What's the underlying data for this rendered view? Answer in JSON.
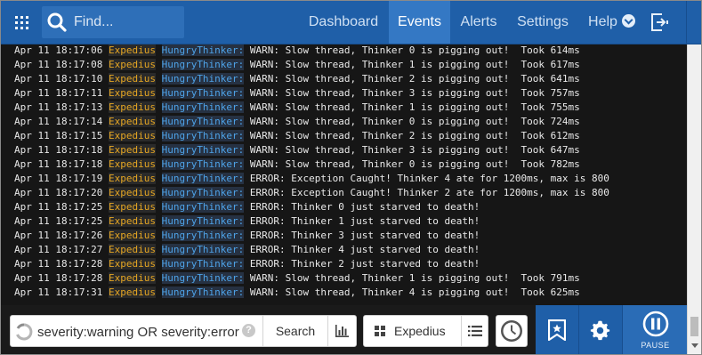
{
  "header": {
    "search_placeholder": "Find...",
    "nav": [
      {
        "label": "Dashboard",
        "active": false
      },
      {
        "label": "Events",
        "active": true
      },
      {
        "label": "Alerts",
        "active": false
      },
      {
        "label": "Settings",
        "active": false
      },
      {
        "label": "Help",
        "active": false
      }
    ],
    "icons": [
      "apps-grid-icon",
      "search-icon",
      "chevron-down-icon",
      "sign-out-icon"
    ]
  },
  "log": {
    "rows": [
      {
        "time": "Apr 11 18:17:06",
        "host": "Expedius",
        "source": "HungryThinker:",
        "message": "WARN: Slow thread, Thinker 0 is pigging out!  Took 614ms"
      },
      {
        "time": "Apr 11 18:17:08",
        "host": "Expedius",
        "source": "HungryThinker:",
        "message": "WARN: Slow thread, Thinker 1 is pigging out!  Took 617ms"
      },
      {
        "time": "Apr 11 18:17:10",
        "host": "Expedius",
        "source": "HungryThinker:",
        "message": "WARN: Slow thread, Thinker 2 is pigging out!  Took 641ms"
      },
      {
        "time": "Apr 11 18:17:11",
        "host": "Expedius",
        "source": "HungryThinker:",
        "message": "WARN: Slow thread, Thinker 3 is pigging out!  Took 757ms"
      },
      {
        "time": "Apr 11 18:17:13",
        "host": "Expedius",
        "source": "HungryThinker:",
        "message": "WARN: Slow thread, Thinker 1 is pigging out!  Took 755ms"
      },
      {
        "time": "Apr 11 18:17:14",
        "host": "Expedius",
        "source": "HungryThinker:",
        "message": "WARN: Slow thread, Thinker 0 is pigging out!  Took 724ms"
      },
      {
        "time": "Apr 11 18:17:15",
        "host": "Expedius",
        "source": "HungryThinker:",
        "message": "WARN: Slow thread, Thinker 2 is pigging out!  Took 612ms"
      },
      {
        "time": "Apr 11 18:17:18",
        "host": "Expedius",
        "source": "HungryThinker:",
        "message": "WARN: Slow thread, Thinker 3 is pigging out!  Took 647ms"
      },
      {
        "time": "Apr 11 18:17:18",
        "host": "Expedius",
        "source": "HungryThinker:",
        "message": "WARN: Slow thread, Thinker 0 is pigging out!  Took 782ms"
      },
      {
        "time": "Apr 11 18:17:19",
        "host": "Expedius",
        "source": "HungryThinker:",
        "message": "ERROR: Exception Caught! Thinker 4 ate for 1200ms, max is 800"
      },
      {
        "time": "Apr 11 18:17:20",
        "host": "Expedius",
        "source": "HungryThinker:",
        "message": "ERROR: Exception Caught! Thinker 2 ate for 1200ms, max is 800"
      },
      {
        "time": "Apr 11 18:17:25",
        "host": "Expedius",
        "source": "HungryThinker:",
        "message": "ERROR: Thinker 0 just starved to death!"
      },
      {
        "time": "Apr 11 18:17:25",
        "host": "Expedius",
        "source": "HungryThinker:",
        "message": "ERROR: Thinker 1 just starved to death!"
      },
      {
        "time": "Apr 11 18:17:26",
        "host": "Expedius",
        "source": "HungryThinker:",
        "message": "ERROR: Thinker 3 just starved to death!"
      },
      {
        "time": "Apr 11 18:17:27",
        "host": "Expedius",
        "source": "HungryThinker:",
        "message": "ERROR: Thinker 4 just starved to death!"
      },
      {
        "time": "Apr 11 18:17:28",
        "host": "Expedius",
        "source": "HungryThinker:",
        "message": "ERROR: Thinker 2 just starved to death!"
      },
      {
        "time": "Apr 11 18:17:28",
        "host": "Expedius",
        "source": "HungryThinker:",
        "message": "WARN: Slow thread, Thinker 1 is pigging out!  Took 791ms"
      },
      {
        "time": "Apr 11 18:17:31",
        "host": "Expedius",
        "source": "HungryThinker:",
        "message": "WARN: Slow thread, Thinker 4 is pigging out!  Took 625ms"
      }
    ]
  },
  "footer": {
    "query": "severity:warning OR severity:error",
    "help_glyph": "?",
    "search_label": "Search",
    "host_label": "Expedius",
    "pause_label": "PAUSE",
    "icons": [
      "loading-spinner-icon",
      "help-icon",
      "bar-chart-icon",
      "tiles-icon",
      "list-icon",
      "clock-icon",
      "bookmark-icon",
      "gear-icon",
      "pause-icon"
    ]
  },
  "colors": {
    "brand_blue": "#1f5fa8",
    "nav_active": "#3478c4",
    "log_background": "#161616",
    "host_text": "#e5a623",
    "source_text": "#4ea3e8"
  }
}
